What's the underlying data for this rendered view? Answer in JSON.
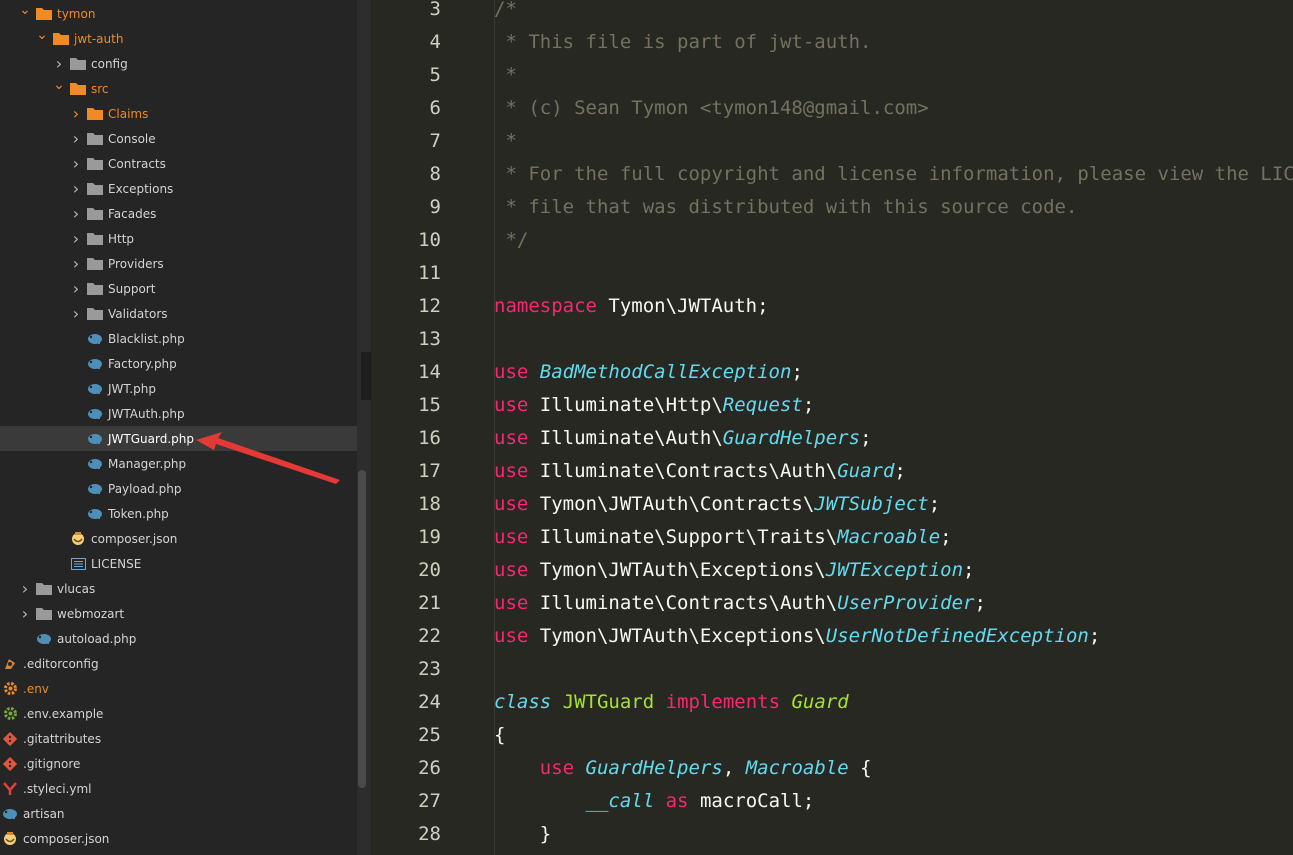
{
  "sidebar": {
    "rows": [
      {
        "label": "tymon",
        "type": "folder",
        "open": true,
        "depth": 0,
        "orange": true
      },
      {
        "label": "jwt-auth",
        "type": "folder",
        "open": true,
        "depth": 1,
        "orange": true
      },
      {
        "label": "config",
        "type": "folder",
        "open": false,
        "depth": 2,
        "orange": false
      },
      {
        "label": "src",
        "type": "folder",
        "open": true,
        "depth": 2,
        "orange": true
      },
      {
        "label": "Claims",
        "type": "folder",
        "open": false,
        "depth": 3,
        "orange": true
      },
      {
        "label": "Console",
        "type": "folder",
        "open": false,
        "depth": 3,
        "orange": false
      },
      {
        "label": "Contracts",
        "type": "folder",
        "open": false,
        "depth": 3,
        "orange": false
      },
      {
        "label": "Exceptions",
        "type": "folder",
        "open": false,
        "depth": 3,
        "orange": false
      },
      {
        "label": "Facades",
        "type": "folder",
        "open": false,
        "depth": 3,
        "orange": false
      },
      {
        "label": "Http",
        "type": "folder",
        "open": false,
        "depth": 3,
        "orange": false
      },
      {
        "label": "Providers",
        "type": "folder",
        "open": false,
        "depth": 3,
        "orange": false
      },
      {
        "label": "Support",
        "type": "folder",
        "open": false,
        "depth": 3,
        "orange": false
      },
      {
        "label": "Validators",
        "type": "folder",
        "open": false,
        "depth": 3,
        "orange": false
      },
      {
        "label": "Blacklist.php",
        "type": "php",
        "depth": 3
      },
      {
        "label": "Factory.php",
        "type": "php",
        "depth": 3
      },
      {
        "label": "JWT.php",
        "type": "php",
        "depth": 3
      },
      {
        "label": "JWTAuth.php",
        "type": "php",
        "depth": 3
      },
      {
        "label": "JWTGuard.php",
        "type": "php",
        "depth": 3,
        "selected": true
      },
      {
        "label": "Manager.php",
        "type": "php",
        "depth": 3
      },
      {
        "label": "Payload.php",
        "type": "php",
        "depth": 3
      },
      {
        "label": "Token.php",
        "type": "php",
        "depth": 3
      },
      {
        "label": "composer.json",
        "type": "composer",
        "depth": 2
      },
      {
        "label": "LICENSE",
        "type": "license",
        "depth": 2
      },
      {
        "label": "vlucas",
        "type": "folder",
        "open": false,
        "depth": 0,
        "orange": false
      },
      {
        "label": "webmozart",
        "type": "folder",
        "open": false,
        "depth": 0,
        "orange": false
      },
      {
        "label": "autoload.php",
        "type": "php",
        "depth": 0
      },
      {
        "label": ".editorconfig",
        "type": "editorconfig",
        "depth": -1
      },
      {
        "label": ".env",
        "type": "gear-orange",
        "depth": -1,
        "orange": true
      },
      {
        "label": ".env.example",
        "type": "gear-green",
        "depth": -1
      },
      {
        "label": ".gitattributes",
        "type": "git",
        "depth": -1
      },
      {
        "label": ".gitignore",
        "type": "git",
        "depth": -1
      },
      {
        "label": ".styleci.yml",
        "type": "yml",
        "depth": -1
      },
      {
        "label": "artisan",
        "type": "php",
        "depth": -1
      },
      {
        "label": "composer.json",
        "type": "composer",
        "depth": -1
      }
    ]
  },
  "editor": {
    "lines": [
      {
        "n": "3",
        "tokens": [
          [
            "c",
            "/*"
          ]
        ]
      },
      {
        "n": "4",
        "tokens": [
          [
            "c",
            " * This file is part of jwt-auth."
          ]
        ]
      },
      {
        "n": "5",
        "tokens": [
          [
            "c",
            " *"
          ]
        ]
      },
      {
        "n": "6",
        "tokens": [
          [
            "c",
            " * (c) Sean Tymon <tymon148@gmail.com>"
          ]
        ]
      },
      {
        "n": "7",
        "tokens": [
          [
            "c",
            " *"
          ]
        ]
      },
      {
        "n": "8",
        "tokens": [
          [
            "c",
            " * For the full copyright and license information, please view the LICENSE"
          ]
        ]
      },
      {
        "n": "9",
        "tokens": [
          [
            "c",
            " * file that was distributed with this source code."
          ]
        ]
      },
      {
        "n": "10",
        "tokens": [
          [
            "c",
            " */"
          ]
        ]
      },
      {
        "n": "11",
        "tokens": []
      },
      {
        "n": "12",
        "tokens": [
          [
            "k",
            "namespace"
          ],
          [
            "p",
            " Tymon\\JWTAuth;"
          ]
        ]
      },
      {
        "n": "13",
        "tokens": []
      },
      {
        "n": "14",
        "tokens": [
          [
            "k",
            "use"
          ],
          [
            "p",
            " "
          ],
          [
            "t",
            "BadMethodCallException"
          ],
          [
            "p",
            ";"
          ]
        ]
      },
      {
        "n": "15",
        "tokens": [
          [
            "k",
            "use"
          ],
          [
            "p",
            " Illuminate\\Http\\"
          ],
          [
            "t",
            "Request"
          ],
          [
            "p",
            ";"
          ]
        ]
      },
      {
        "n": "16",
        "tokens": [
          [
            "k",
            "use"
          ],
          [
            "p",
            " Illuminate\\Auth\\"
          ],
          [
            "t",
            "GuardHelpers"
          ],
          [
            "p",
            ";"
          ]
        ]
      },
      {
        "n": "17",
        "tokens": [
          [
            "k",
            "use"
          ],
          [
            "p",
            " Illuminate\\Contracts\\Auth\\"
          ],
          [
            "t",
            "Guard"
          ],
          [
            "p",
            ";"
          ]
        ]
      },
      {
        "n": "18",
        "tokens": [
          [
            "k",
            "use"
          ],
          [
            "p",
            " Tymon\\JWTAuth\\Contracts\\"
          ],
          [
            "t",
            "JWTSubject"
          ],
          [
            "p",
            ";"
          ]
        ]
      },
      {
        "n": "19",
        "tokens": [
          [
            "k",
            "use"
          ],
          [
            "p",
            " Illuminate\\Support\\Traits\\"
          ],
          [
            "t",
            "Macroable"
          ],
          [
            "p",
            ";"
          ]
        ]
      },
      {
        "n": "20",
        "tokens": [
          [
            "k",
            "use"
          ],
          [
            "p",
            " Tymon\\JWTAuth\\Exceptions\\"
          ],
          [
            "t",
            "JWTException"
          ],
          [
            "p",
            ";"
          ]
        ]
      },
      {
        "n": "21",
        "tokens": [
          [
            "k",
            "use"
          ],
          [
            "p",
            " Illuminate\\Contracts\\Auth\\"
          ],
          [
            "t",
            "UserProvider"
          ],
          [
            "p",
            ";"
          ]
        ]
      },
      {
        "n": "22",
        "tokens": [
          [
            "k",
            "use"
          ],
          [
            "p",
            " Tymon\\JWTAuth\\Exceptions\\"
          ],
          [
            "t",
            "UserNotDefinedException"
          ],
          [
            "p",
            ";"
          ]
        ]
      },
      {
        "n": "23",
        "tokens": []
      },
      {
        "n": "24",
        "tokens": [
          [
            "t",
            "class"
          ],
          [
            "p",
            " "
          ],
          [
            "g",
            "JWTGuard"
          ],
          [
            "p",
            " "
          ],
          [
            "k",
            "implements"
          ],
          [
            "p",
            " "
          ],
          [
            "gi",
            "Guard"
          ]
        ]
      },
      {
        "n": "25",
        "tokens": [
          [
            "p",
            "{"
          ]
        ]
      },
      {
        "n": "26",
        "tokens": [
          [
            "p",
            "    "
          ],
          [
            "k",
            "use"
          ],
          [
            "p",
            " "
          ],
          [
            "t",
            "GuardHelpers"
          ],
          [
            "p",
            ", "
          ],
          [
            "t",
            "Macroable"
          ],
          [
            "p",
            " {"
          ]
        ]
      },
      {
        "n": "27",
        "tokens": [
          [
            "p",
            "        "
          ],
          [
            "t",
            "__call"
          ],
          [
            "p",
            " "
          ],
          [
            "k",
            "as"
          ],
          [
            "p",
            " macroCall;"
          ]
        ]
      },
      {
        "n": "28",
        "tokens": [
          [
            "p",
            "    }"
          ]
        ]
      }
    ]
  },
  "colors": {
    "comment": "#75715e",
    "keyword": "#f92672",
    "type": "#66d9ef",
    "class": "#a6e22e",
    "plain": "#f8f8f2",
    "accent": "#f08a24"
  }
}
